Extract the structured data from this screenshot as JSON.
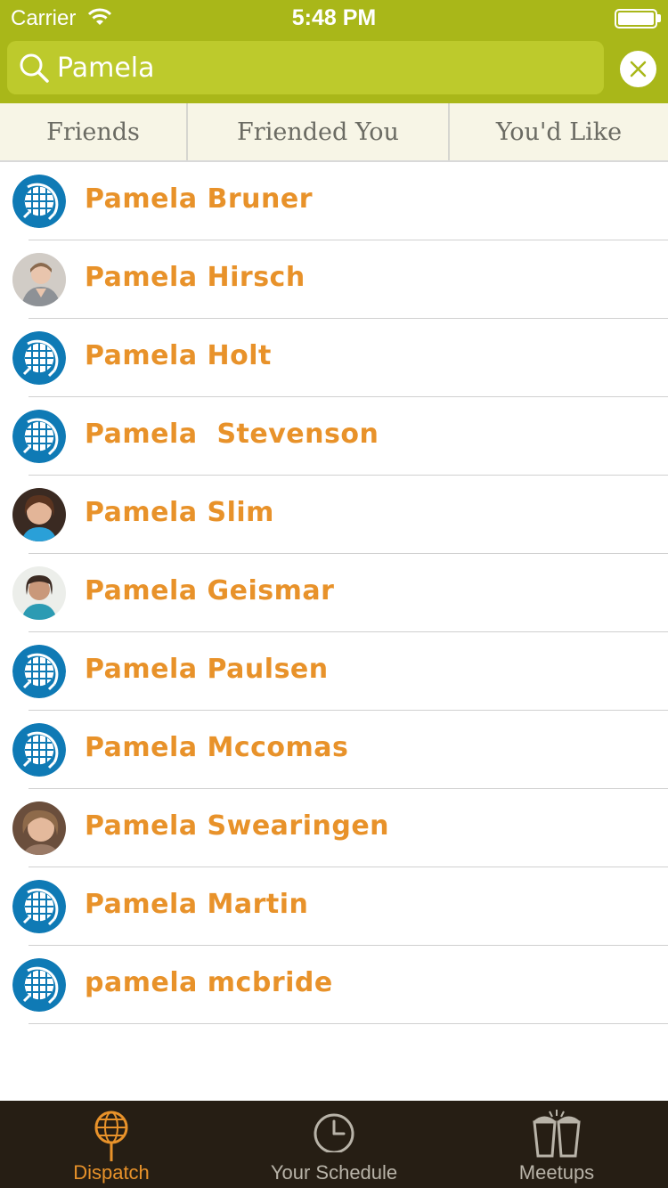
{
  "status_bar": {
    "carrier": "Carrier",
    "time": "5:48 PM"
  },
  "search": {
    "value": "Pamela",
    "placeholder": ""
  },
  "tabs": [
    "Friends",
    "Friended You",
    "You'd Like"
  ],
  "results": [
    {
      "name": "Pamela Bruner",
      "avatar": "globe-icon"
    },
    {
      "name": "Pamela Hirsch",
      "avatar": "photo"
    },
    {
      "name": "Pamela Holt",
      "avatar": "globe-icon"
    },
    {
      "name": "Pamela  Stevenson",
      "avatar": "globe-icon"
    },
    {
      "name": "Pamela Slim",
      "avatar": "photo"
    },
    {
      "name": "Pamela Geismar",
      "avatar": "photo"
    },
    {
      "name": "Pamela Paulsen",
      "avatar": "globe-icon"
    },
    {
      "name": "Pamela Mccomas",
      "avatar": "globe-icon"
    },
    {
      "name": "Pamela Swearingen",
      "avatar": "photo"
    },
    {
      "name": "Pamela Martin",
      "avatar": "globe-icon"
    },
    {
      "name": "pamela mcbride",
      "avatar": "globe-icon"
    }
  ],
  "tabbar": [
    {
      "label": "Dispatch",
      "icon": "dispatch-globe-icon",
      "active": true
    },
    {
      "label": "Your Schedule",
      "icon": "clock-icon",
      "active": false
    },
    {
      "label": "Meetups",
      "icon": "drinks-icon",
      "active": false
    }
  ],
  "colors": {
    "header": "#a9b719",
    "accent": "#e8922a",
    "tabbar": "#261e14",
    "avatar_blue": "#0f7ab5"
  }
}
